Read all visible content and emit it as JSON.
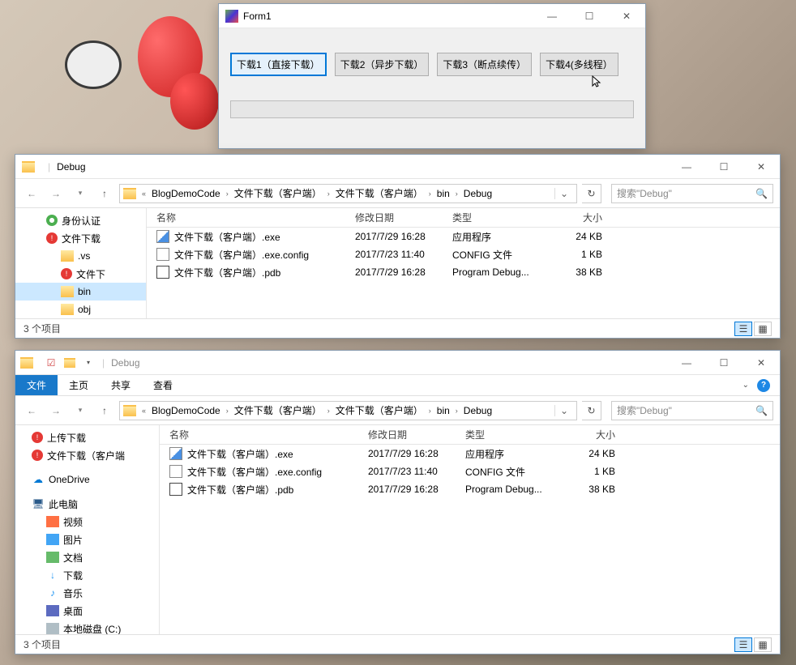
{
  "form1": {
    "title": "Form1",
    "buttons": {
      "b1": "下载1（直接下载）",
      "b2": "下载2（异步下载）",
      "b3": "下载3（断点续传）",
      "b4": "下载4(多线程）"
    }
  },
  "explorer1": {
    "title": "Debug",
    "breadcrumb": {
      "seg1": "BlogDemoCode",
      "seg2": "文件下载（客户端）",
      "seg3": "文件下载（客户端）",
      "seg4": "bin",
      "seg5": "Debug"
    },
    "search_placeholder": "搜索\"Debug\"",
    "tree": {
      "t1": "身份认证",
      "t2": "文件下载",
      "t3": ".vs",
      "t4": "文件下",
      "t5": "bin",
      "t6": "obj"
    },
    "columns": {
      "name": "名称",
      "date": "修改日期",
      "type": "类型",
      "size": "大小"
    },
    "rows": [
      {
        "name": "文件下载（客户端）.exe",
        "date": "2017/7/29 16:28",
        "type": "应用程序",
        "size": "24 KB"
      },
      {
        "name": "文件下载（客户端）.exe.config",
        "date": "2017/7/23 11:40",
        "type": "CONFIG 文件",
        "size": "1 KB"
      },
      {
        "name": "文件下载（客户端）.pdb",
        "date": "2017/7/29 16:28",
        "type": "Program Debug...",
        "size": "38 KB"
      }
    ],
    "status": "3 个项目"
  },
  "explorer2": {
    "title": "Debug",
    "ribbon": {
      "file": "文件",
      "home": "主页",
      "share": "共享",
      "view": "查看"
    },
    "breadcrumb": {
      "seg1": "BlogDemoCode",
      "seg2": "文件下载（客户端）",
      "seg3": "文件下载（客户端）",
      "seg4": "bin",
      "seg5": "Debug"
    },
    "search_placeholder": "搜索\"Debug\"",
    "tree": {
      "t1": "上传下载",
      "t2": "文件下载（客户端",
      "t3": "OneDrive",
      "t4": "此电脑",
      "t5": "视频",
      "t6": "图片",
      "t7": "文档",
      "t8": "下载",
      "t9": "音乐",
      "t10": "桌面",
      "t11": "本地磁盘 (C:)"
    },
    "columns": {
      "name": "名称",
      "date": "修改日期",
      "type": "类型",
      "size": "大小"
    },
    "rows": [
      {
        "name": "文件下载（客户端）.exe",
        "date": "2017/7/29 16:28",
        "type": "应用程序",
        "size": "24 KB"
      },
      {
        "name": "文件下载（客户端）.exe.config",
        "date": "2017/7/23 11:40",
        "type": "CONFIG 文件",
        "size": "1 KB"
      },
      {
        "name": "文件下载（客户端）.pdb",
        "date": "2017/7/29 16:28",
        "type": "Program Debug...",
        "size": "38 KB"
      }
    ],
    "status": "3 个项目"
  }
}
